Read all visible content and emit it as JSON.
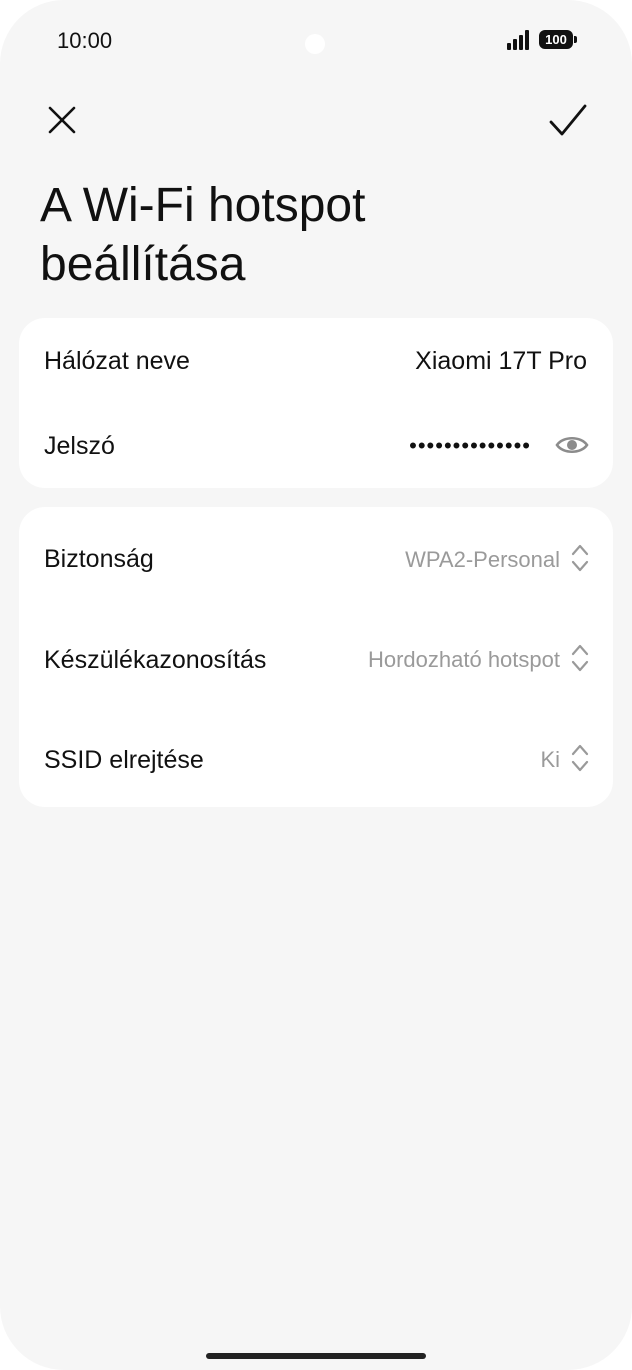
{
  "status_bar": {
    "time": "10:00",
    "battery": "100"
  },
  "header": {
    "title": "A Wi-Fi hotspot beállítása"
  },
  "network_card": {
    "name_label": "Hálózat neve",
    "name_value": "Xiaomi 17T Pro",
    "password_label": "Jelszó",
    "password_value": "••••••••••••••"
  },
  "settings_card": {
    "security_label": "Biztonság",
    "security_value": "WPA2-Personal",
    "device_id_label": "Készülékazonosítás",
    "device_id_value": "Hordozható hotspot",
    "hide_ssid_label": "SSID elrejtése",
    "hide_ssid_value": "Ki"
  },
  "icons": {
    "close": "close-icon",
    "confirm": "checkmark-icon",
    "password_visibility": "eye-icon",
    "dropdown": "chevron-updown-icon"
  }
}
